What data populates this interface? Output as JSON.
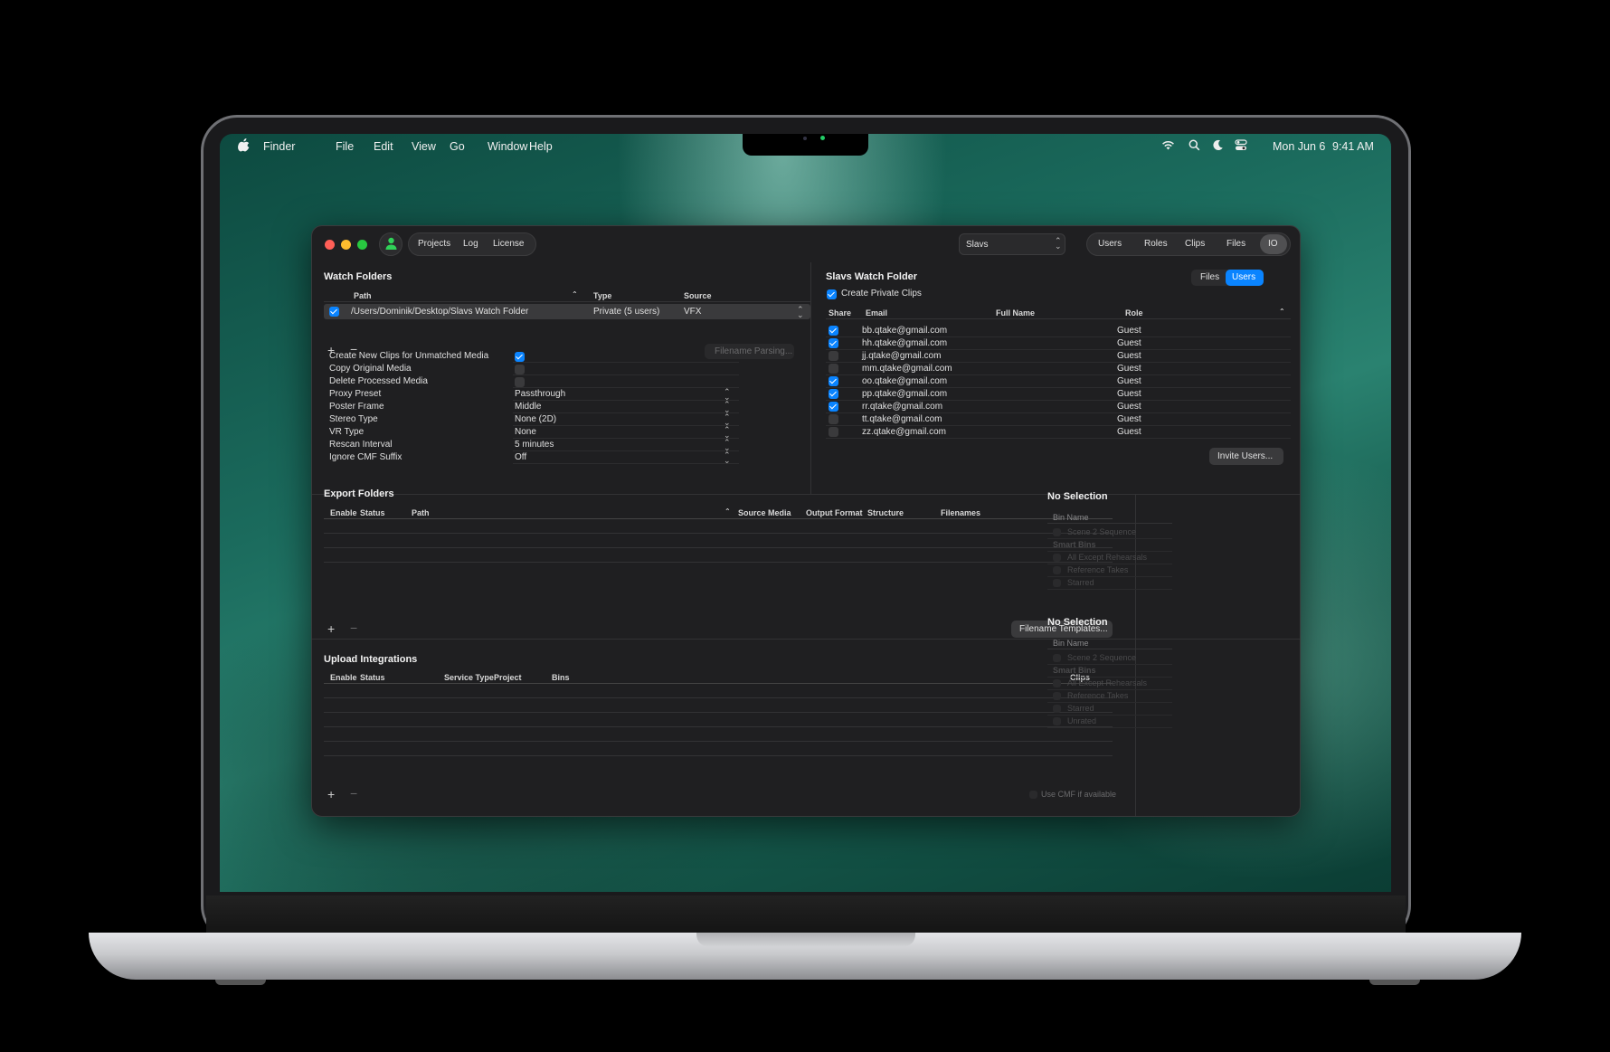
{
  "menubar": {
    "finder": "Finder",
    "items": [
      "File",
      "Edit",
      "View",
      "Go",
      "Window",
      "Help"
    ],
    "date": "Mon Jun 6",
    "time": "9:41 AM"
  },
  "toolbar": {
    "left_tabs": [
      "Projects",
      "Log",
      "License"
    ],
    "project_select": "Slavs",
    "right_tabs": [
      "Users",
      "Roles",
      "Clips",
      "Files",
      "IO"
    ],
    "selected_tab": "IO"
  },
  "watch": {
    "title": "Watch Folders",
    "columns": {
      "path": "Path",
      "type": "Type",
      "source": "Source"
    },
    "row": {
      "path": "/Users/Dominik/Desktop/Slavs Watch Folder",
      "type": "Private (5 users)",
      "source": "VFX"
    },
    "add": "+",
    "remove": "−",
    "filename_parsing": "Filename Parsing...",
    "settings": [
      {
        "label": "Create New Clips for Unmatched Media",
        "kind": "check",
        "checked": true
      },
      {
        "label": "Copy Original Media",
        "kind": "check",
        "checked": false
      },
      {
        "label": "Delete Processed Media",
        "kind": "check",
        "checked": false
      },
      {
        "label": "Proxy Preset",
        "kind": "select",
        "value": "Passthrough"
      },
      {
        "label": "Poster Frame",
        "kind": "select",
        "value": "Middle"
      },
      {
        "label": "Stereo Type",
        "kind": "select",
        "value": "None (2D)"
      },
      {
        "label": "VR Type",
        "kind": "select",
        "value": "None"
      },
      {
        "label": "Rescan Interval",
        "kind": "select",
        "value": "5 minutes"
      },
      {
        "label": "Ignore CMF Suffix",
        "kind": "select",
        "value": "Off"
      }
    ]
  },
  "slavs": {
    "title": "Slavs Watch Folder",
    "seg": [
      "Files",
      "Users"
    ],
    "create_private": "Create Private Clips",
    "columns": {
      "share": "Share",
      "email": "Email",
      "full_name": "Full Name",
      "role": "Role"
    },
    "rows": [
      {
        "email": "bb.qtake@gmail.com",
        "role": "Guest",
        "share": true
      },
      {
        "email": "hh.qtake@gmail.com",
        "role": "Guest",
        "share": true
      },
      {
        "email": "jj.qtake@gmail.com",
        "role": "Guest",
        "share": false
      },
      {
        "email": "mm.qtake@gmail.com",
        "role": "Guest",
        "share": false
      },
      {
        "email": "oo.qtake@gmail.com",
        "role": "Guest",
        "share": true
      },
      {
        "email": "pp.qtake@gmail.com",
        "role": "Guest",
        "share": true
      },
      {
        "email": "rr.qtake@gmail.com",
        "role": "Guest",
        "share": true
      },
      {
        "email": "tt.qtake@gmail.com",
        "role": "Guest",
        "share": false
      },
      {
        "email": "zz.qtake@gmail.com",
        "role": "Guest",
        "share": false
      }
    ],
    "invite": "Invite Users..."
  },
  "export": {
    "title": "Export Folders",
    "columns": [
      "Enable",
      "Status",
      "Path",
      "Source Media",
      "Output Format",
      "Structure",
      "Filenames"
    ],
    "templates": "Filename Templates...",
    "add": "+",
    "remove": "−"
  },
  "upload": {
    "title": "Upload Integrations",
    "columns": [
      "Enable",
      "Status",
      "Service Type",
      "Project",
      "Bins",
      "Clips"
    ],
    "use_cmf": "Use CMF if available",
    "add": "+",
    "remove": "−"
  },
  "side1": {
    "title": "No Selection",
    "bin_name": "Bin Name",
    "items": [
      "Scene 2 Sequence",
      "Smart Bins",
      "All Except Rehearsals",
      "Reference Takes",
      "Starred"
    ]
  },
  "side2": {
    "title": "No Selection",
    "bin_name": "Bin Name",
    "items": [
      "Scene 2 Sequence",
      "Smart Bins",
      "All Except Rehearsals",
      "Reference Takes",
      "Starred",
      "Unrated"
    ]
  }
}
